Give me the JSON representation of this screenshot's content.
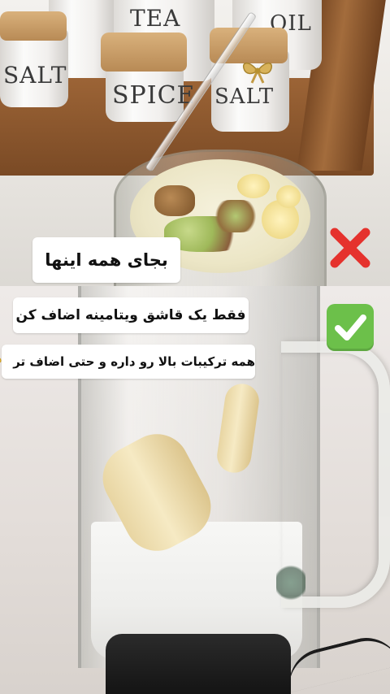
{
  "top_section": {
    "caption": "بجای همه اینها",
    "status_icon": "red-cross-icon",
    "jar_labels": [
      "SALT",
      "SPICE",
      "SALT",
      "TEA",
      "OIL"
    ],
    "colors": {
      "cross": "#e5322d"
    }
  },
  "bottom_section": {
    "caption_main": "فقط یک قاشق ویتامینه اضاف کن",
    "caption_sub": "همه ترکیبات بالا رو داره و حتی اضاف تر",
    "sub_emoji": "pinching-hand-icon",
    "status_icon": "green-check-icon",
    "colors": {
      "check": "#6cc04a"
    }
  }
}
